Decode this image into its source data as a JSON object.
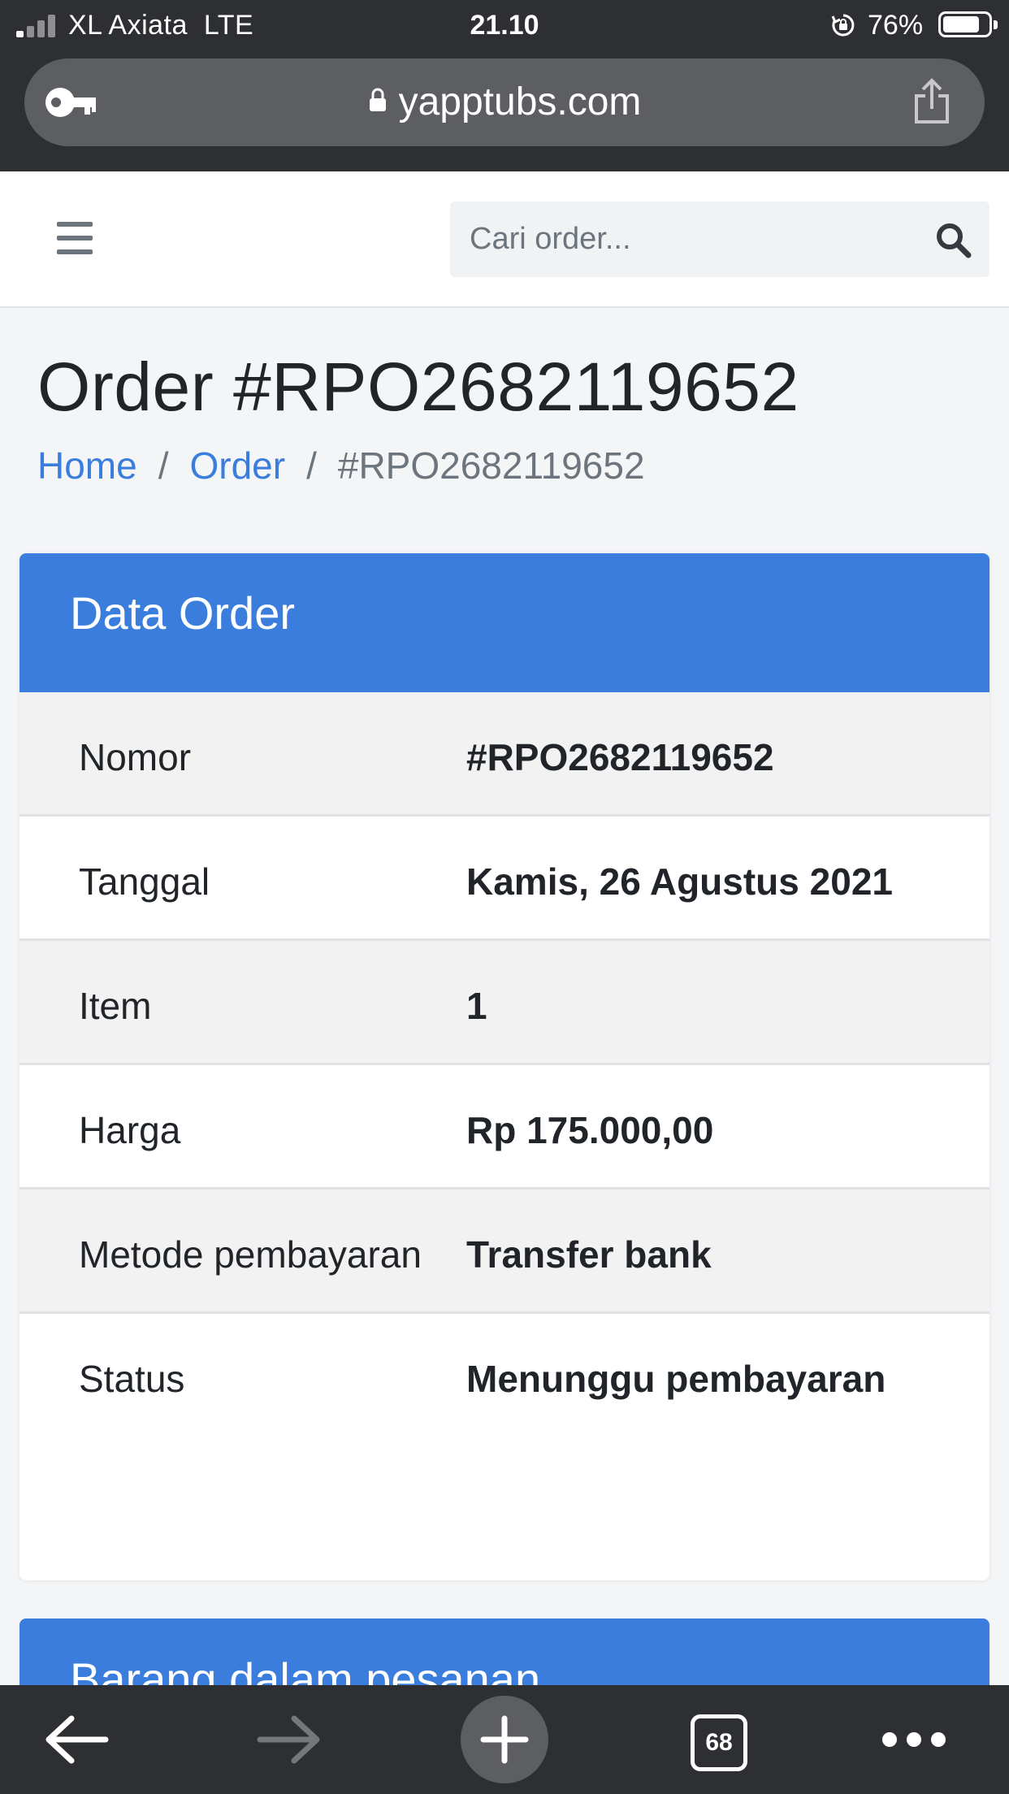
{
  "status_bar": {
    "carrier": "XL Axiata",
    "network": "LTE",
    "time": "21.10",
    "battery": "76%"
  },
  "browser": {
    "url": "yapptubs.com",
    "tab_count": "68"
  },
  "header": {
    "search_placeholder": "Cari order..."
  },
  "page": {
    "title": "Order #RPO2682119652",
    "breadcrumb": [
      "Home",
      "Order",
      "#RPO2682119652"
    ]
  },
  "order_card": {
    "title": "Data Order",
    "rows": [
      {
        "label": "Nomor",
        "value": "#RPO2682119652"
      },
      {
        "label": "Tanggal",
        "value": "Kamis, 26 Agustus 2021"
      },
      {
        "label": "Item",
        "value": "1"
      },
      {
        "label": "Harga",
        "value": "Rp 175.000,00"
      },
      {
        "label": "Metode pembayaran",
        "value": "Transfer bank"
      },
      {
        "label": "Status",
        "value": "Menunggu pembayaran"
      }
    ]
  },
  "items_card": {
    "title": "Barang dalam pesanan"
  },
  "colors": {
    "primary": "#3b7ddd",
    "chrome": "#2d2f32",
    "url_bar": "#5c5e62"
  }
}
